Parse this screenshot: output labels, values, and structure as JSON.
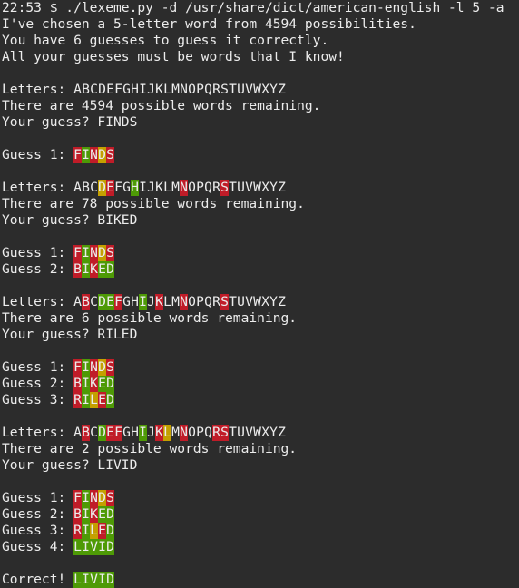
{
  "lines": [
    {
      "t": "22:53 $ ./lexeme.py -d /usr/share/dict/american-english -l 5 -a"
    },
    {
      "t": "I've chosen a 5-letter word from 4594 possibilities."
    },
    {
      "t": "You have 6 guesses to guess it correctly."
    },
    {
      "t": "All your guesses must be words that I know!"
    },
    {
      "t": ""
    },
    {
      "prefix": "Letters: ",
      "cells": "ABCDEFGHIJKLMNOPQRSTUVWXYZ",
      "colors": ".........................."
    },
    {
      "t": "There are 4594 possible words remaining."
    },
    {
      "t": "Your guess? FINDS"
    },
    {
      "t": ""
    },
    {
      "prefix": "Guess 1: ",
      "cells": "FINDS",
      "colors": "rgryr"
    },
    {
      "t": ""
    },
    {
      "prefix": "Letters: ",
      "cells": "ABCDEFGHIJKLMNOPQRSTUVWXYZ",
      "colors": "...yr..g.....r....r......."
    },
    {
      "t": "There are 78 possible words remaining."
    },
    {
      "t": "Your guess? BIKED"
    },
    {
      "t": ""
    },
    {
      "prefix": "Guess 1: ",
      "cells": "FINDS",
      "colors": "rgryr"
    },
    {
      "prefix": "Guess 2: ",
      "cells": "BIKED",
      "colors": "rgrgg"
    },
    {
      "t": ""
    },
    {
      "prefix": "Letters: ",
      "cells": "ABCDEFGHIJKLMNOPQRSTUVWXYZ",
      "colors": ".r.ggr..g.r..r....r......."
    },
    {
      "t": "There are 6 possible words remaining."
    },
    {
      "t": "Your guess? RILED"
    },
    {
      "t": ""
    },
    {
      "prefix": "Guess 1: ",
      "cells": "FINDS",
      "colors": "rgryr"
    },
    {
      "prefix": "Guess 2: ",
      "cells": "BIKED",
      "colors": "rgrgg"
    },
    {
      "prefix": "Guess 3: ",
      "cells": "RILED",
      "colors": "rgyrg"
    },
    {
      "t": ""
    },
    {
      "prefix": "Letters: ",
      "cells": "ABCDEFGHIJKLMNOPQRSTUVWXYZ",
      "colors": ".r.grr..g.ry.r...rr......."
    },
    {
      "t": "There are 2 possible words remaining."
    },
    {
      "t": "Your guess? LIVID"
    },
    {
      "t": ""
    },
    {
      "prefix": "Guess 1: ",
      "cells": "FINDS",
      "colors": "rgryr"
    },
    {
      "prefix": "Guess 2: ",
      "cells": "BIKED",
      "colors": "rgrgg"
    },
    {
      "prefix": "Guess 3: ",
      "cells": "RILED",
      "colors": "rgyrg"
    },
    {
      "prefix": "Guess 4: ",
      "cells": "LIVID",
      "colors": "ggggg"
    },
    {
      "t": ""
    },
    {
      "prefix": "Correct! ",
      "cells": "LIVID",
      "colors": "ggggg"
    }
  ],
  "colors": {
    "r": "#c01c28",
    "y": "#c4a000",
    "g": "#4e9a06",
    "background": "#2c2c2c",
    "foreground": "#ececec"
  }
}
